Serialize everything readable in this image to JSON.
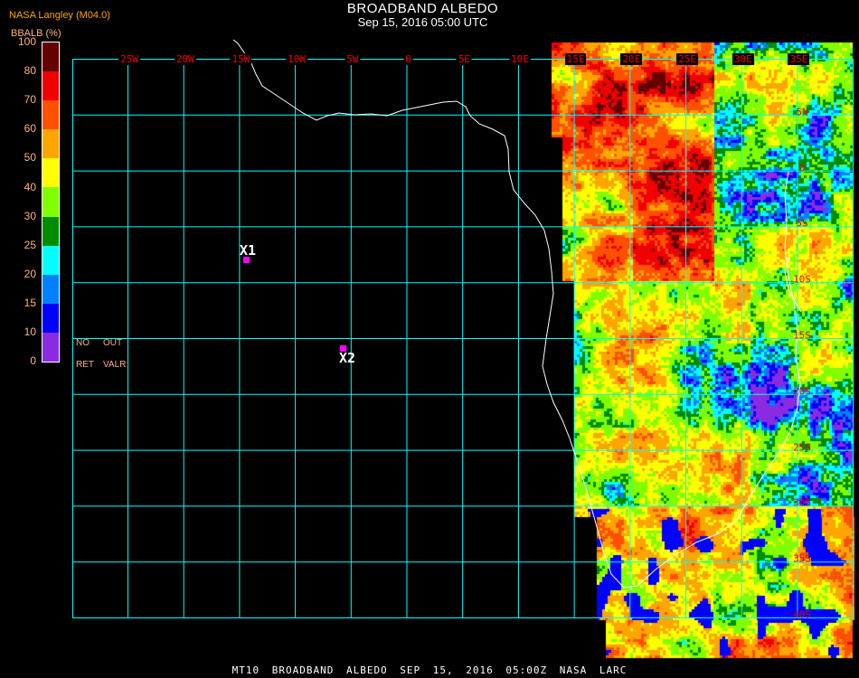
{
  "header": {
    "title": "BROADBAND ALBEDO",
    "subtitle": "Sep 15, 2016 05:00 UTC",
    "producer": "NASA Langley (M04.0)"
  },
  "legend": {
    "label": "BBALB (%)",
    "ticks": [
      "100",
      "80",
      "70",
      "60",
      "50",
      "40",
      "30",
      "25",
      "20",
      "15",
      "10",
      "0"
    ],
    "colors": [
      "#640000",
      "#f00000",
      "#ff5000",
      "#ffa500",
      "#ffff00",
      "#80ff00",
      "#008c00",
      "#00ffff",
      "#0080ff",
      "#0000ff",
      "#8a2be2"
    ],
    "no_ret": "NO",
    "ret": "RET",
    "out": "OUT",
    "valr": "VALR"
  },
  "map": {
    "grid_color": "#00ffff",
    "coast_color": "#ffffff",
    "lon_labels": [
      "25W",
      "20W",
      "15W",
      "10W",
      "5W",
      "0",
      "5E",
      "10E",
      "15E",
      "20E",
      "25E",
      "30E",
      "35E"
    ],
    "lat_labels": [
      "5N",
      "0",
      "5S",
      "10S",
      "15S",
      "20S",
      "25S",
      "30S",
      "35S",
      "40S"
    ],
    "markers": [
      {
        "label": "X1",
        "color": "#ff00ff"
      },
      {
        "label": "X2",
        "color": "#ff00ff"
      }
    ]
  },
  "footer": "MT10  BROADBAND ALBEDO   SEP 15, 2016 05:00Z   NASA LARC"
}
